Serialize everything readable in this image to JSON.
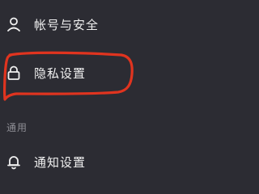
{
  "menu": {
    "items": [
      {
        "label": "帐号与安全",
        "icon": "person-icon"
      },
      {
        "label": "隐私设置",
        "icon": "lock-icon"
      }
    ]
  },
  "general_section": {
    "title": "通用",
    "items": [
      {
        "label": "通知设置",
        "icon": "bell-icon"
      }
    ]
  },
  "colors": {
    "background": "#2c2c33",
    "text": "#f0f0f0",
    "section_title": "#8e8e95",
    "annotation": "#e0341f"
  }
}
